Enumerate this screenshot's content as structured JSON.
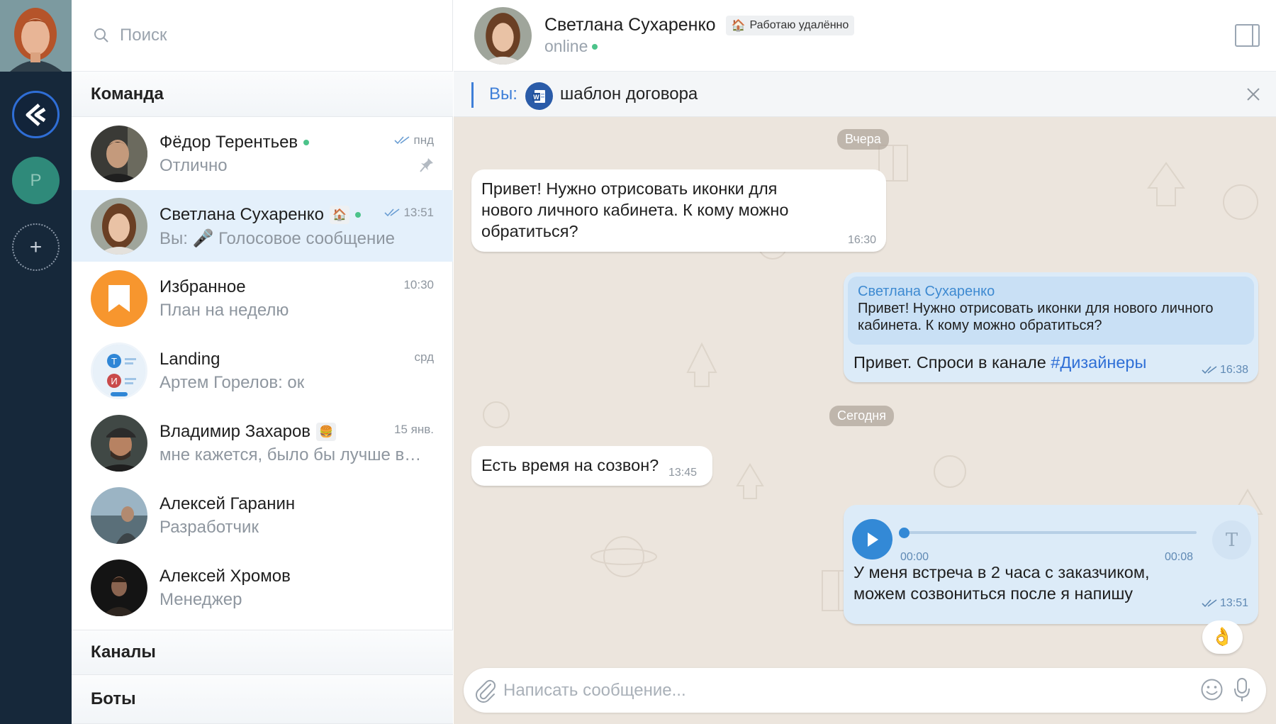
{
  "search": {
    "placeholder": "Поиск",
    "icon": "search-icon"
  },
  "rail": {
    "workspace_letter": "P",
    "add_label": "+"
  },
  "sections": {
    "team": "Команда",
    "channels": "Каналы",
    "bots": "Боты"
  },
  "chats": [
    {
      "name": "Фёдор Терентьев",
      "preview": "Отлично",
      "time": "пнд",
      "online": true,
      "read": true,
      "pinned": true
    },
    {
      "name": "Светлана Сухаренко",
      "preview": "Вы: 🎤 Голосовое сообщение",
      "time": "13:51",
      "online": true,
      "read": true,
      "status_emoji": "🏠"
    },
    {
      "name": "Избранное",
      "preview": "План на неделю",
      "time": "10:30"
    },
    {
      "name": "Landing",
      "preview": "Артем Горелов: ок",
      "time": "срд",
      "avatar_letters": [
        "Т",
        "И"
      ]
    },
    {
      "name": "Владимир Захаров",
      "preview": "мне кажется, было бы лучше в…",
      "time": "15 янв.",
      "status_emoji": "🍔"
    },
    {
      "name": "Алексей Гаранин",
      "preview": "Разработчик"
    },
    {
      "name": "Алексей Хромов",
      "preview": "Менеджер"
    }
  ],
  "header": {
    "name": "Светлана Сухаренко",
    "status_chip": "Работаю удалённо",
    "status_chip_emoji": "🏠",
    "presence": "online"
  },
  "pinned": {
    "prefix": "Вы:",
    "text": "шаблон договора",
    "doc_icon": "W"
  },
  "messages": {
    "date_yesterday": "Вчера",
    "date_today": "Сегодня",
    "m1": {
      "text": "Привет! Нужно отрисовать иконки для нового личного кабинета. К кому можно обратиться?",
      "time": "16:30"
    },
    "m2": {
      "quote_author": "Светлана Сухаренко",
      "quote_text": "Привет! Нужно отрисовать иконки для нового личного кабинета. К кому можно обратиться?",
      "text_before": "Привет. Спроси в канале ",
      "hashtag": "#Дизайнеры",
      "time": "16:38"
    },
    "m3": {
      "text": "Есть время на созвон?",
      "time": "13:45"
    },
    "m4": {
      "voice_position": "00:00",
      "voice_duration": "00:08",
      "transcribe_label": "T",
      "text": "У меня встреча в 2 часа с заказчиком, можем созвониться после я напишу",
      "time": "13:51",
      "reaction": "👌"
    }
  },
  "composer": {
    "placeholder": "Написать сообщение..."
  },
  "colors": {
    "rail": "#16283a",
    "accent": "#3389d6",
    "active_chat": "#e4f0fb",
    "online": "#4cc38a",
    "chat_bg": "#ece5dd",
    "outgoing": "#dcebf8"
  }
}
